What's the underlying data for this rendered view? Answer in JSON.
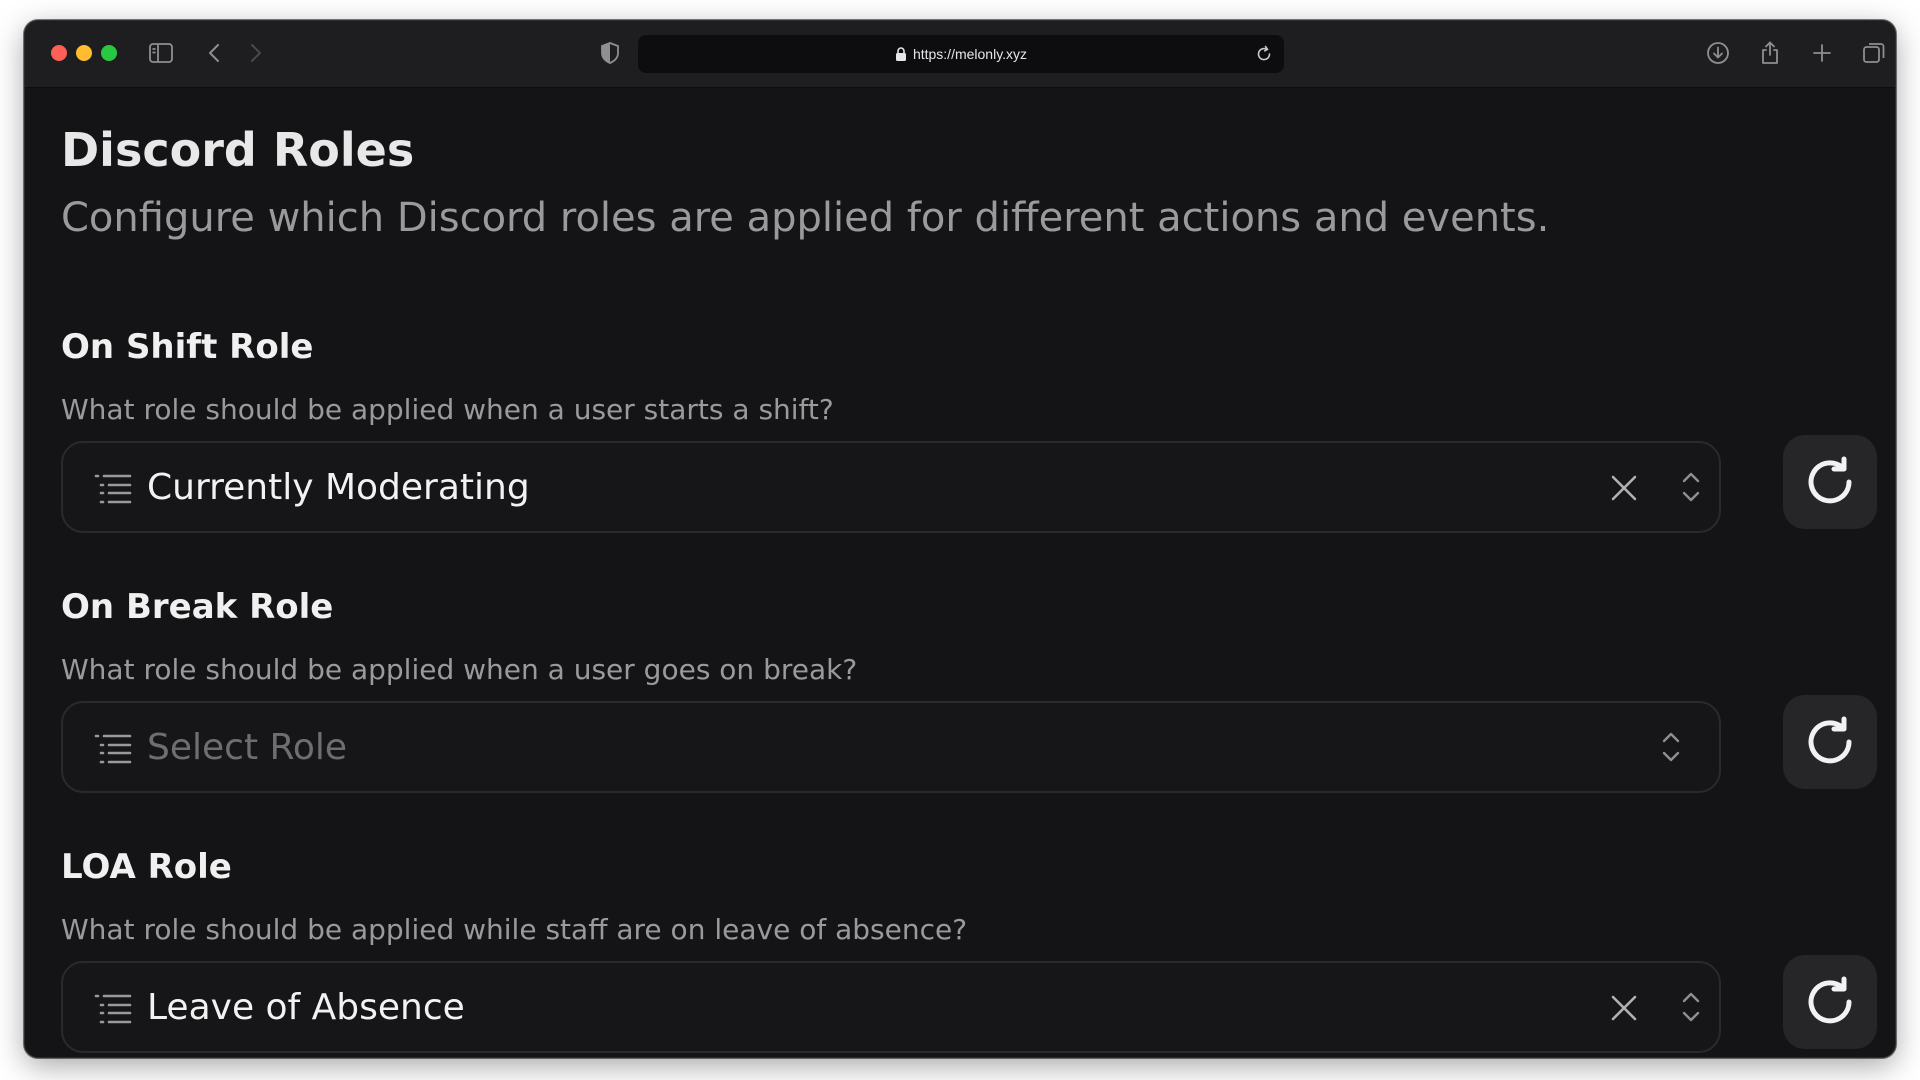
{
  "browser": {
    "url": "https://melonly.xyz"
  },
  "page": {
    "title": "Discord Roles",
    "description": "Configure which Discord roles are applied for different actions and events."
  },
  "sections": [
    {
      "title": "On Shift Role",
      "description": "What role should be applied when a user starts a shift?",
      "value": "Currently Moderating",
      "has_value": true
    },
    {
      "title": "On Break Role",
      "description": "What role should be applied when a user goes on break?",
      "placeholder": "Select Role",
      "has_value": false
    },
    {
      "title": "LOA Role",
      "description": "What role should be applied while staff are on leave of absence?",
      "value": "Leave of Absence",
      "has_value": true
    }
  ],
  "colors": {
    "background": "#141416",
    "titlebar": "#1e1e20",
    "select_border": "#2a2a2d",
    "reset_button": "#262628",
    "muted_text": "#9a9a9e"
  },
  "icons": {
    "sidebar": "sidebar-icon",
    "back": "chevron-left-icon",
    "forward": "chevron-right-icon",
    "shield": "shield-icon",
    "lock": "lock-icon",
    "reload": "reload-icon",
    "download": "download-icon",
    "share": "share-icon",
    "new_tab": "plus-icon",
    "tabs": "tabs-overview-icon",
    "list": "list-icon",
    "clear": "close-icon",
    "chevrons": "chevron-up-down-icon",
    "reset": "refresh-icon"
  }
}
